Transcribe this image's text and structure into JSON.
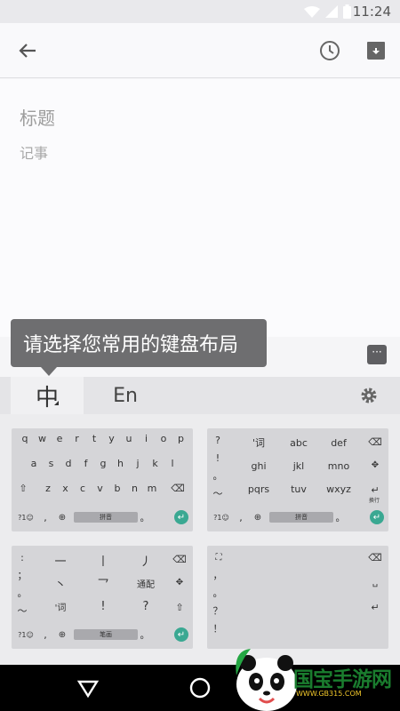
{
  "status_bar": {
    "time": "11:24"
  },
  "toolbar": {
    "back_icon": "arrow-left-icon",
    "reminder_icon": "clock-icon",
    "archive_icon": "archive-icon"
  },
  "note": {
    "title_placeholder": "标题",
    "body_placeholder": "记事"
  },
  "tooltip": {
    "text": "请选择您常用的键盘布局"
  },
  "more_button": {
    "label": "···"
  },
  "keyboard_tabs": {
    "chinese": "中",
    "english": "En",
    "settings_icon": "gear-icon"
  },
  "layouts": {
    "qwerty": {
      "row1": [
        "q",
        "w",
        "e",
        "r",
        "t",
        "y",
        "u",
        "i",
        "o",
        "p"
      ],
      "row2": [
        "a",
        "s",
        "d",
        "f",
        "g",
        "h",
        "j",
        "k",
        "l"
      ],
      "row3": [
        "z",
        "x",
        "c",
        "v",
        "b",
        "n",
        "m"
      ],
      "sym": "?1☺",
      "comma": ",",
      "space": "拼音",
      "period": "。"
    },
    "t9": {
      "side": [
        "?",
        "!",
        "。",
        "～"
      ],
      "keys": [
        "'词",
        "abc",
        "def",
        "ghi",
        "jkl",
        "mno",
        "pqrs",
        "tuv",
        "wxyz"
      ],
      "enter_label": "换行",
      "sym": "?1☺",
      "comma": ",",
      "space": "拼音",
      "period": "。"
    },
    "stroke": {
      "side": [
        ":",
        "；",
        "。",
        "～"
      ],
      "keys": [
        "一",
        "丨",
        "丿",
        "丶",
        "乛",
        "通配",
        "'词",
        "!",
        "?"
      ],
      "sym": "?1☺",
      "comma": ",",
      "space": "笔画",
      "period": "。"
    },
    "handwriting": {
      "side": [
        "，",
        "。",
        "？",
        "！"
      ]
    }
  },
  "watermark": {
    "text": "国宝手游网",
    "url": "WWW.GB315.COM"
  }
}
